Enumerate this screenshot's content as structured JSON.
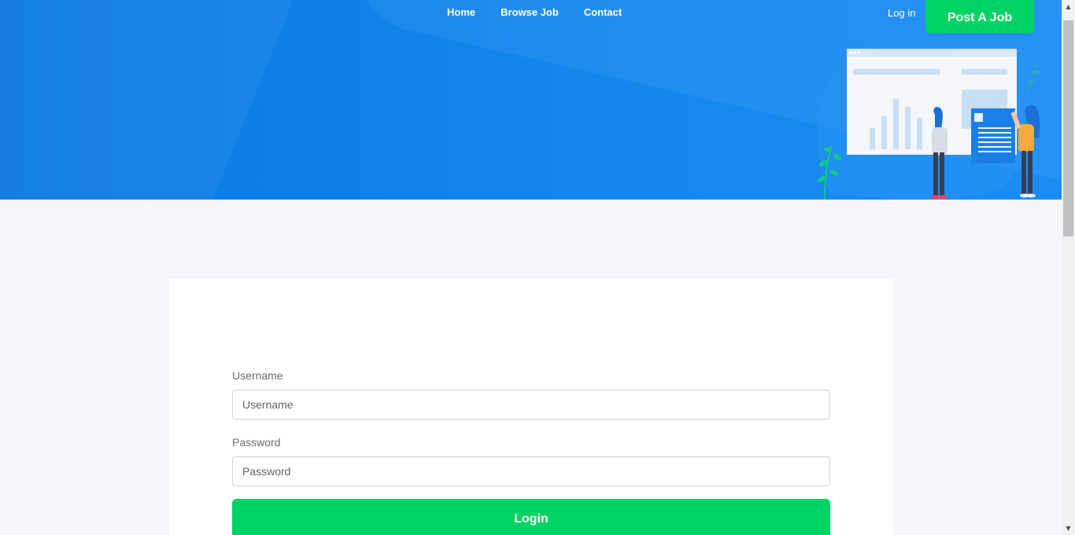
{
  "nav": {
    "items": [
      {
        "label": "Home"
      },
      {
        "label": "Browse Job"
      },
      {
        "label": "Contact"
      }
    ],
    "login_label": "Log in",
    "post_job_label": "Post A Job"
  },
  "form": {
    "username": {
      "label": "Username",
      "placeholder": "Username",
      "value": ""
    },
    "password": {
      "label": "Password",
      "placeholder": "Password",
      "value": ""
    },
    "submit_label": "Login"
  },
  "colors": {
    "hero_blue": "#1486ee",
    "accent_green": "#00d363",
    "page_bg": "#f5f6fa"
  },
  "icons": {
    "hero_illustration": "dashboard-illustration-icon",
    "scroll_up": "chevron-up-icon",
    "scroll_down": "chevron-down-icon"
  }
}
